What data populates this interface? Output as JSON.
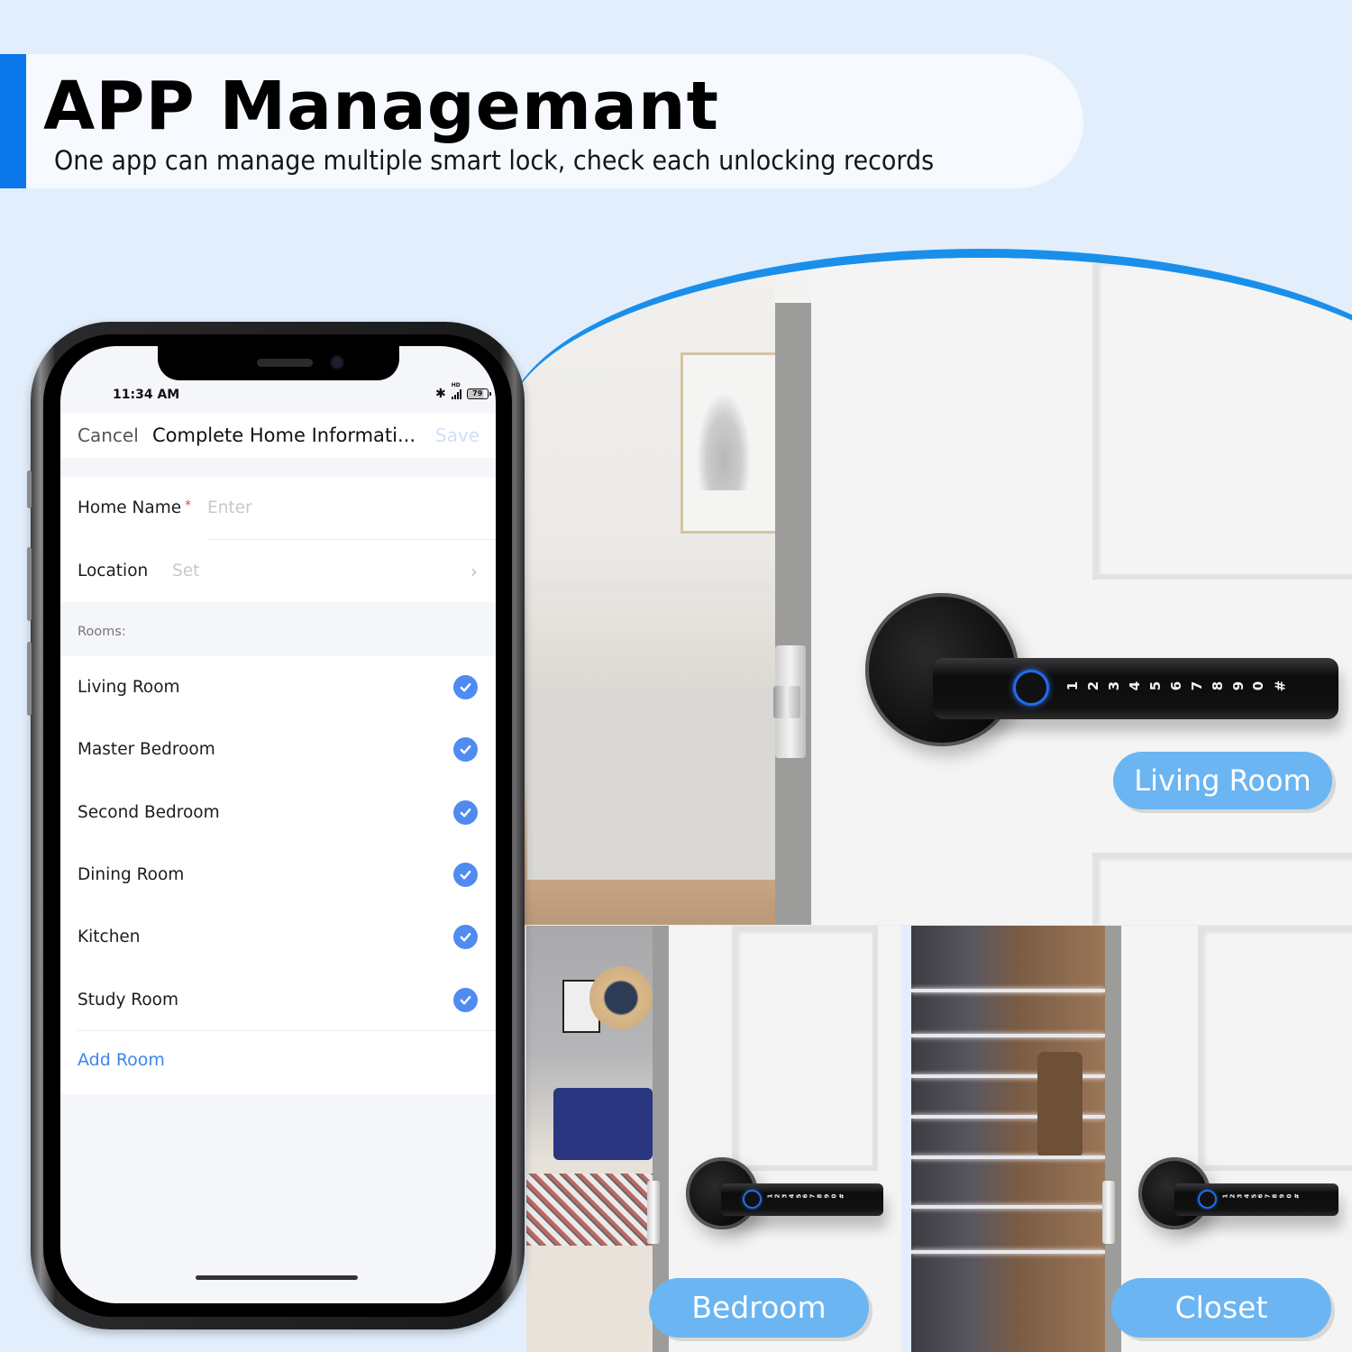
{
  "banner": {
    "title": "APP Managemant",
    "subtitle": "One app can manage multiple smart lock, check each unlocking records",
    "accent_color": "#0a78ea"
  },
  "phone": {
    "status_bar": {
      "time": "11:34 AM",
      "bluetooth_icon": "bluetooth-icon",
      "network_label": "HD",
      "battery_level": "79"
    },
    "nav": {
      "cancel_label": "Cancel",
      "title": "Complete Home Informati...",
      "save_label": "Save"
    },
    "form": {
      "home_name": {
        "label": "Home Name",
        "required_mark": "*",
        "placeholder": "Enter"
      },
      "location": {
        "label": "Location",
        "placeholder": "Set"
      }
    },
    "rooms": {
      "header": "Rooms:",
      "items": [
        {
          "label": "Living Room",
          "checked": true
        },
        {
          "label": "Master Bedroom",
          "checked": true
        },
        {
          "label": "Second Bedroom",
          "checked": true
        },
        {
          "label": "Dining Room",
          "checked": true
        },
        {
          "label": "Kitchen",
          "checked": true
        },
        {
          "label": "Study Room",
          "checked": true
        }
      ],
      "add_label": "Add Room",
      "check_color": "#4f8bf0"
    }
  },
  "scenes": {
    "main_tag": "Living Room",
    "bedroom_tag": "Bedroom",
    "closet_tag": "Closet",
    "keypad": [
      "1",
      "2",
      "3",
      "4",
      "5",
      "6",
      "7",
      "8",
      "9",
      "0",
      "#"
    ],
    "tag_color": "#6bb5f2"
  }
}
